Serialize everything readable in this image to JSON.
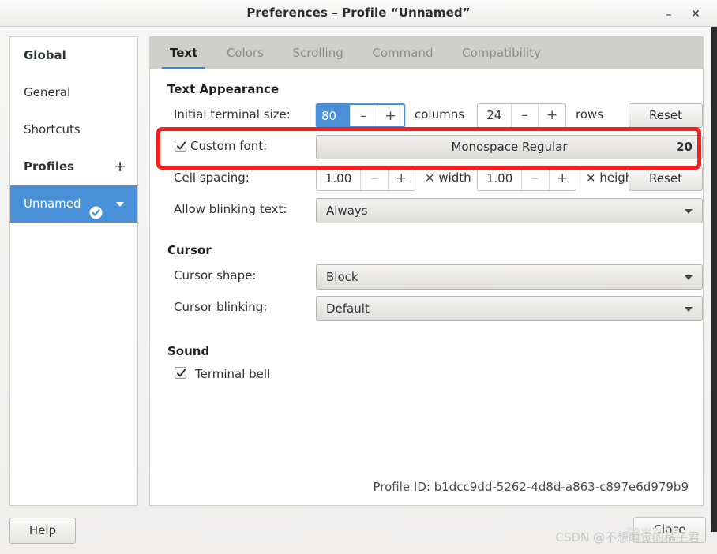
{
  "window": {
    "title": "Preferences – Profile “Unnamed”",
    "minimize_label": "–",
    "close_label": "✕"
  },
  "sidebar": {
    "items": [
      {
        "label": "Global",
        "bold": true,
        "selected": false
      },
      {
        "label": "General",
        "bold": false,
        "selected": false
      },
      {
        "label": "Shortcuts",
        "bold": false,
        "selected": false
      },
      {
        "label": "Profiles",
        "bold": true,
        "selected": false,
        "plus": "+"
      },
      {
        "label": "Unnamed",
        "bold": false,
        "selected": true
      }
    ]
  },
  "tabs": [
    {
      "label": "Text",
      "active": true
    },
    {
      "label": "Colors",
      "active": false
    },
    {
      "label": "Scrolling",
      "active": false
    },
    {
      "label": "Command",
      "active": false
    },
    {
      "label": "Compatibility",
      "active": false
    }
  ],
  "sections": {
    "text_appearance": {
      "heading": "Text Appearance",
      "terminal_size": {
        "label": "Initial terminal size:",
        "columns_value": "80",
        "columns_unit": "columns",
        "rows_value": "24",
        "rows_unit": "rows",
        "minus": "–",
        "plus": "+",
        "reset_label": "Reset"
      },
      "custom_font": {
        "label": "Custom font:",
        "checked": true,
        "font_name": "Monospace Regular",
        "font_size": "20"
      },
      "cell_spacing": {
        "label": "Cell spacing:",
        "width_value": "1.00",
        "width_unit": "× width",
        "height_value": "1.00",
        "height_unit": "× height",
        "minus": "–",
        "plus": "+",
        "reset_label": "Reset"
      },
      "blinking": {
        "label": "Allow blinking text:",
        "value": "Always"
      }
    },
    "cursor": {
      "heading": "Cursor",
      "shape": {
        "label": "Cursor shape:",
        "value": "Block"
      },
      "blinking": {
        "label": "Cursor blinking:",
        "value": "Default"
      }
    },
    "sound": {
      "heading": "Sound",
      "terminal_bell": {
        "label": "Terminal bell",
        "checked": true
      }
    }
  },
  "profile_id": "Profile ID: b1dcc9dd-5262-4d8d-a863-c897e6d979b9",
  "footer": {
    "help_label": "Help",
    "close_label": "Close"
  },
  "watermark": {
    "text": "CSDN @不想睡觉的稿子君",
    "overlay": "znwx.cn"
  },
  "colors": {
    "accent": "#4a90d9",
    "tab_accent": "#3584e4",
    "annotation": "#f61f1f",
    "panel_bg": "#ffffff",
    "window_bg": "#f0f0ef"
  }
}
